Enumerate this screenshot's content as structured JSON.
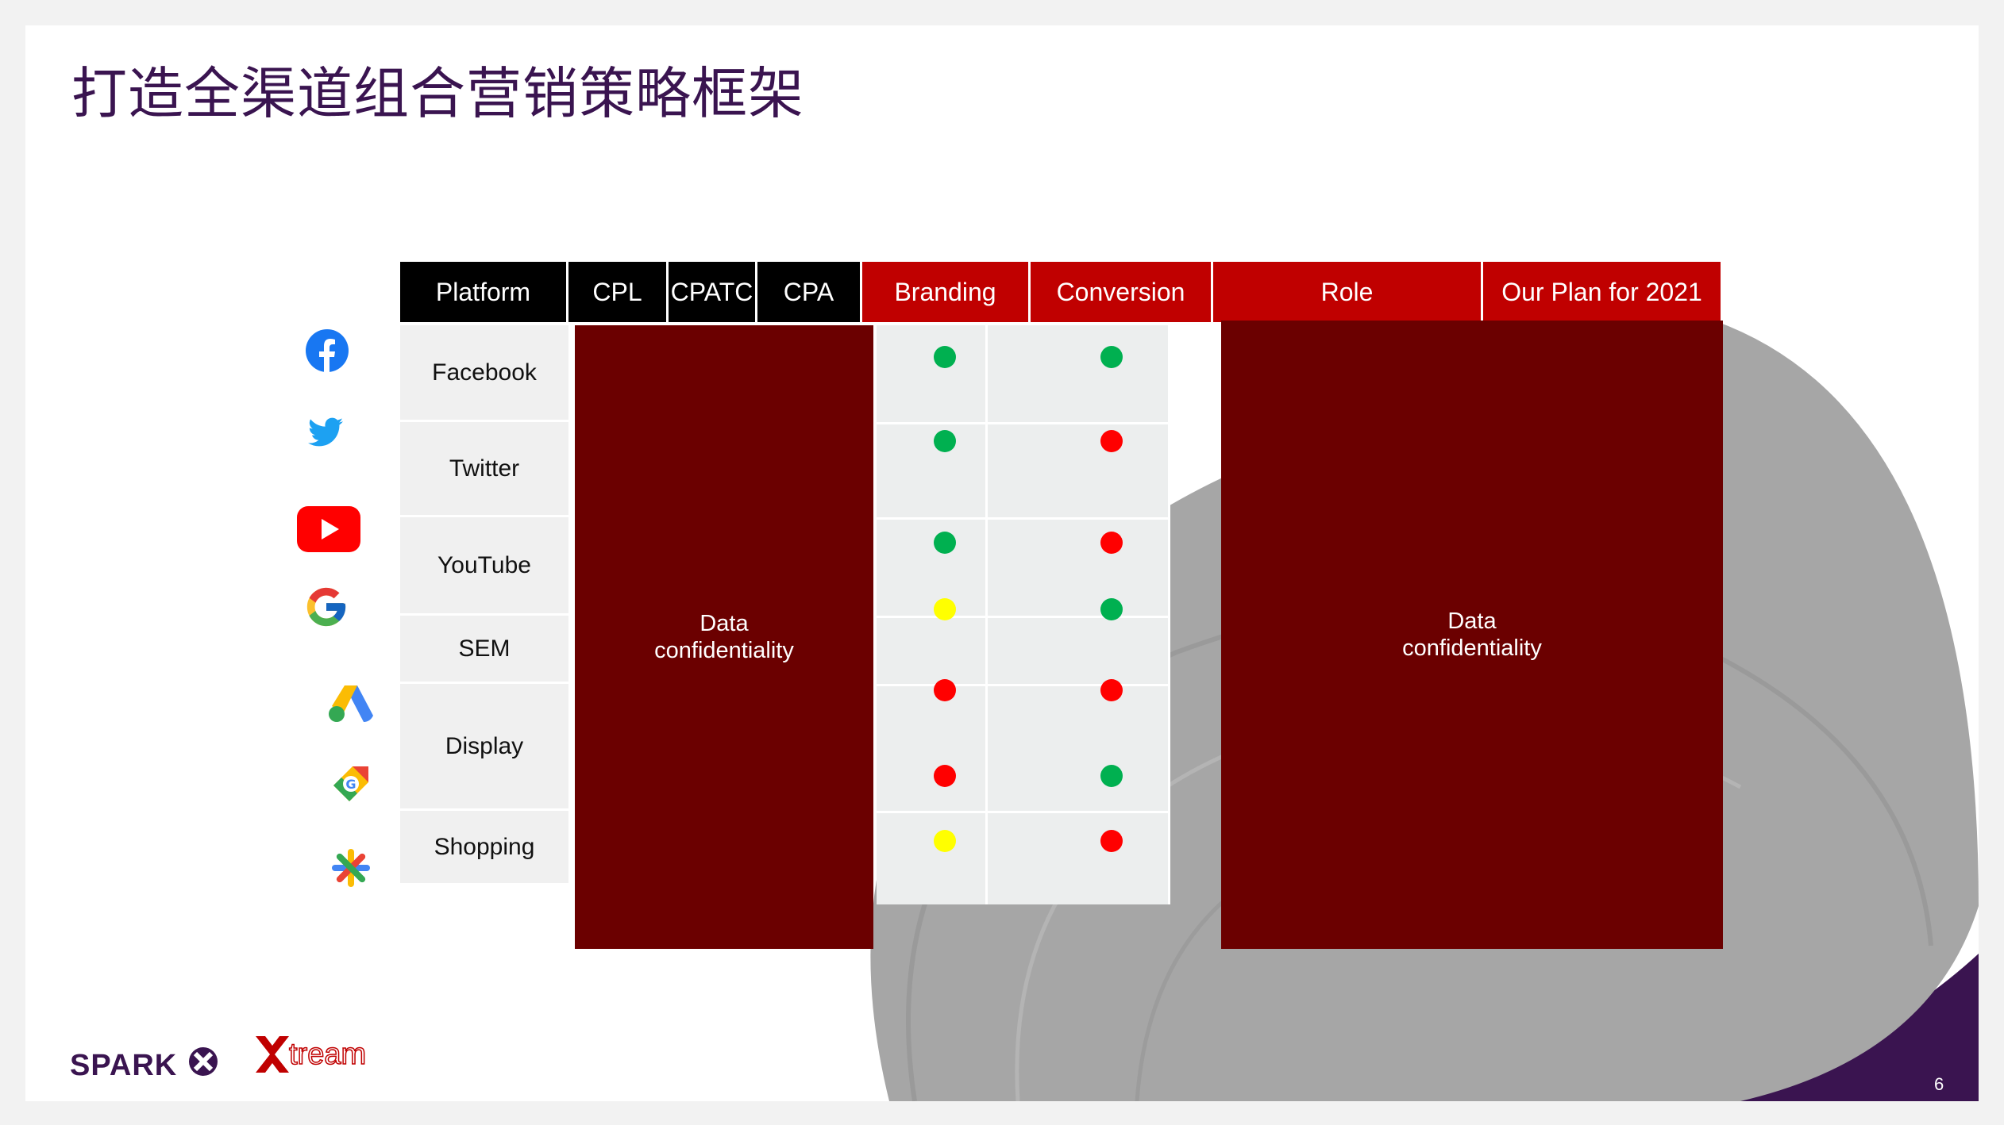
{
  "title": "打造全渠道组合营销策略框架",
  "page_number": "6",
  "logos": {
    "spark": "SPARK",
    "xtream": "Xtream"
  },
  "table": {
    "headers": [
      {
        "label": "Platform",
        "style": "black"
      },
      {
        "label": "CPL",
        "style": "black"
      },
      {
        "label": "CPATC",
        "style": "black"
      },
      {
        "label": "CPA",
        "style": "black"
      },
      {
        "label": "Branding",
        "style": "red"
      },
      {
        "label": "Conversion",
        "style": "red"
      },
      {
        "label": "Role",
        "style": "red"
      },
      {
        "label": "Our Plan for 2021",
        "style": "red"
      }
    ],
    "platforms": [
      "Facebook",
      "Twitter",
      "YouTube",
      "SEM",
      "Display",
      "Shopping"
    ],
    "metrics_block_text": "Data\nconfidentiality",
    "role_block_text": "Data\nconfidentiality",
    "branding": [
      "green",
      "green",
      "green",
      "yellow",
      "red",
      "red",
      "yellow"
    ],
    "conversion": [
      "green",
      "red",
      "red",
      "green",
      "red",
      "green",
      "red"
    ]
  },
  "icons": [
    "facebook-icon",
    "twitter-icon",
    "youtube-icon",
    "google-icon",
    "google-ads-icon",
    "google-shopping-icon",
    "google-marketing-icon"
  ],
  "colors": {
    "title": "#3a1450",
    "header_black": "#000000",
    "header_red": "#c00000",
    "confidential_block": "#6b0000",
    "green": "#00b050",
    "red": "#ff0000",
    "yellow": "#ffff00",
    "decor_gray": "#a6a6a6",
    "decor_purple": "#3a1450"
  }
}
